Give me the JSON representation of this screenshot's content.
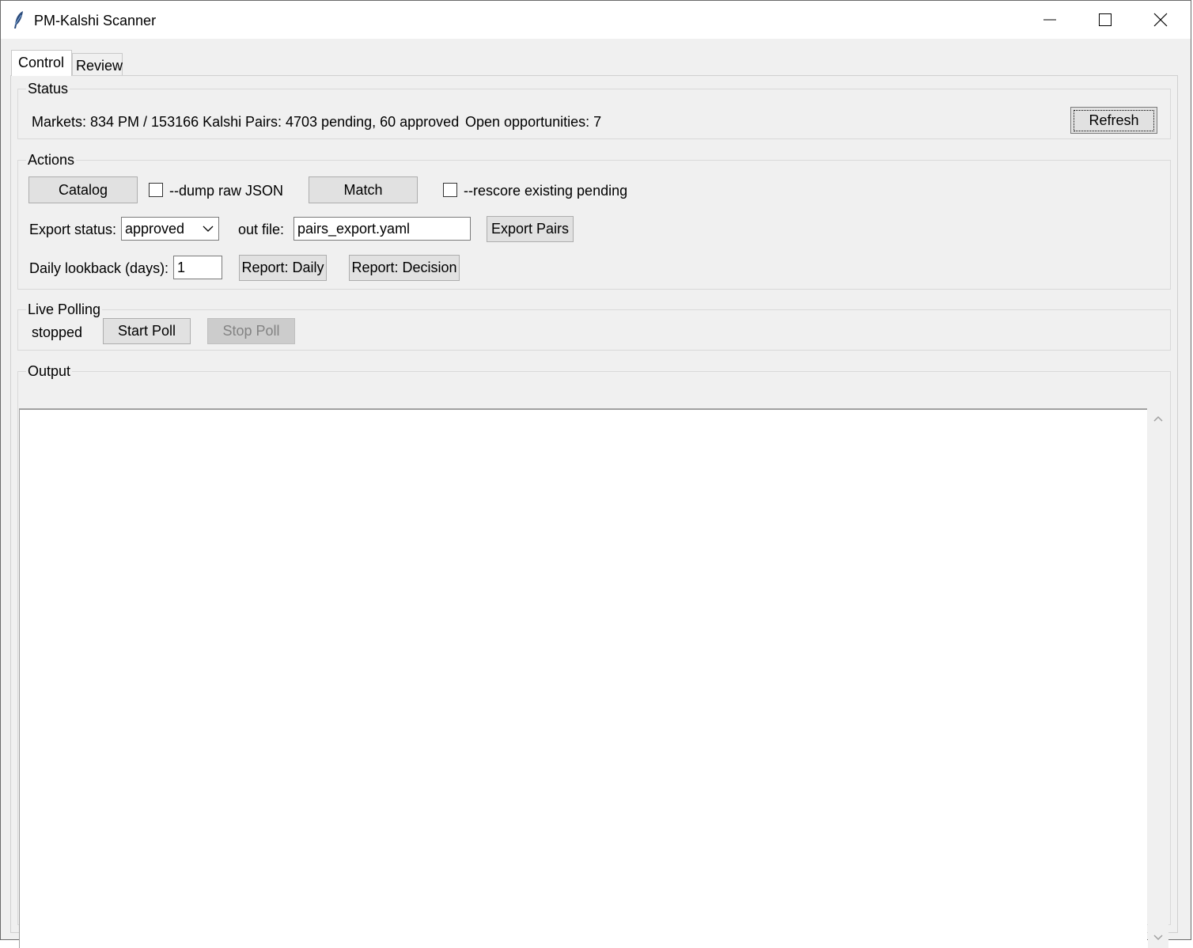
{
  "window": {
    "title": "PM-Kalshi Scanner",
    "icon": "feather-icon"
  },
  "tabs": [
    {
      "label": "Control",
      "selected": true
    },
    {
      "label": "Review",
      "selected": false
    }
  ],
  "status": {
    "frame_label": "Status",
    "markets": "Markets: 834 PM / 153166 Kalshi",
    "pairs": "Pairs: 4703 pending, 60 approved",
    "opportunities": "Open opportunities: 7",
    "refresh_label": "Refresh"
  },
  "actions": {
    "frame_label": "Actions",
    "catalog_label": "Catalog",
    "dump_json_label": "--dump raw JSON",
    "dump_json_checked": false,
    "match_label": "Match",
    "rescore_label": "--rescore existing pending",
    "rescore_checked": false,
    "export_status_label": "Export status:",
    "export_status_value": "approved",
    "out_file_label": "out file:",
    "out_file_value": "pairs_export.yaml",
    "export_pairs_label": "Export Pairs",
    "daily_lookback_label": "Daily lookback (days):",
    "daily_lookback_value": "1",
    "report_daily_label": "Report: Daily",
    "report_decision_label": "Report: Decision"
  },
  "live_polling": {
    "frame_label": "Live Polling",
    "state": "stopped",
    "start_label": "Start Poll",
    "stop_label": "Stop Poll",
    "stop_disabled": true
  },
  "output": {
    "frame_label": "Output",
    "text": ""
  }
}
